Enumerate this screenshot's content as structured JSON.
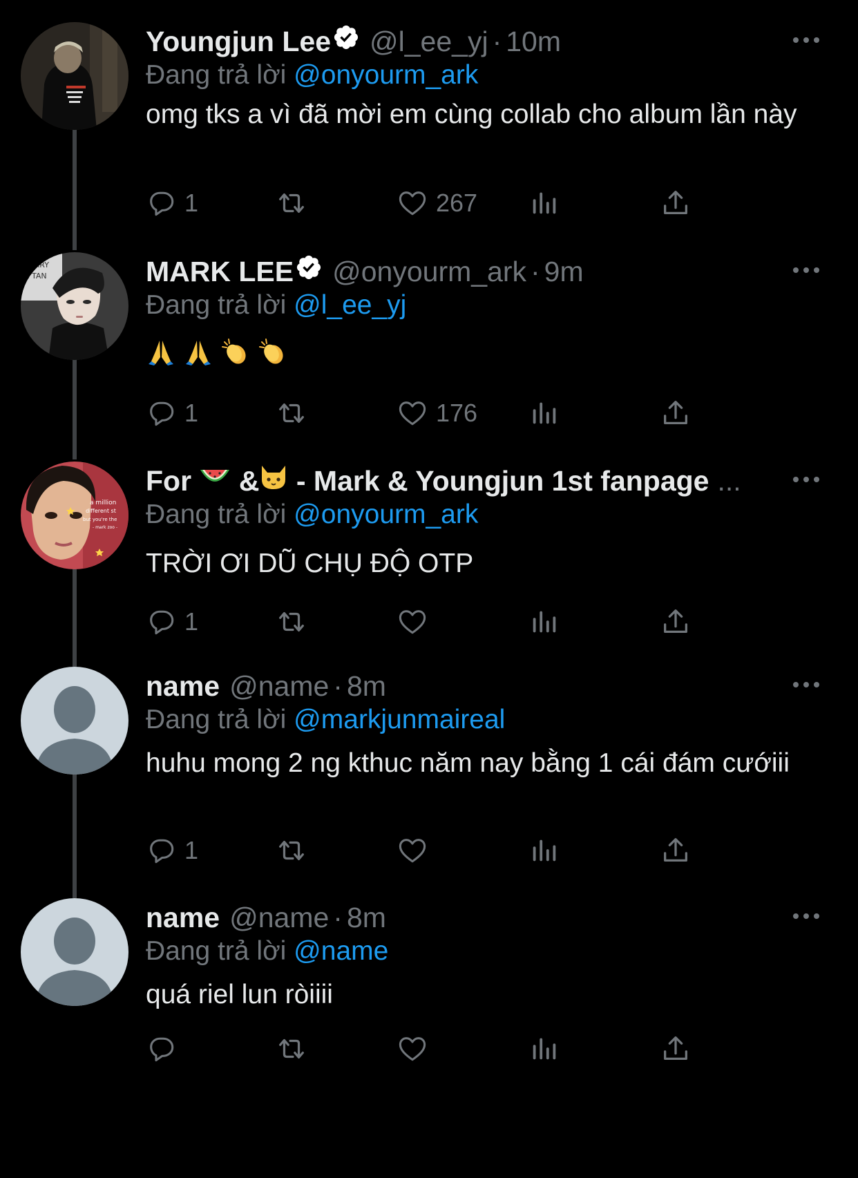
{
  "colors": {
    "background": "#000000",
    "text": "#e7e9ea",
    "secondary": "#71767b",
    "link": "#1d9bf0",
    "thread_line": "#3e4144"
  },
  "reply_prefix": "Đang trả lời",
  "tweets": [
    {
      "display_name": "Youngjun Lee",
      "verified": true,
      "handle": "@l_ee_yj",
      "time": "10m",
      "reply_to": "@onyourm_ark",
      "text": "omg tks a vì đã mời em cùng collab cho album lần này",
      "reply_count": "1",
      "like_count": "267",
      "avatar": "photo-dark-hoodie"
    },
    {
      "display_name": "MARK LEE",
      "verified": true,
      "handle": "@onyourm_ark",
      "time": "9m",
      "reply_to": "@l_ee_yj",
      "text": "",
      "emoji": [
        "folded-hands-emoji",
        "folded-hands-emoji",
        "clapping-hands-emoji",
        "clapping-hands-emoji"
      ],
      "reply_count": "1",
      "like_count": "176",
      "avatar": "photo-portrait"
    },
    {
      "display_name_parts": [
        "For",
        "&",
        "- Mark & Youngjun 1st fanpage"
      ],
      "name_emoji": [
        "watermelon-emoji",
        "cat-face-emoji"
      ],
      "truncated": "...",
      "verified": false,
      "reply_to": "@onyourm_ark",
      "text": "TRỜI ƠI DŨ CHỤ ĐỘ OTP",
      "reply_count": "1",
      "like_count": "",
      "avatar": "photo-fanpage",
      "avatar_caption": [
        "a million",
        "different st",
        "but you're the",
        "- mark zoo -"
      ]
    },
    {
      "display_name": "name",
      "verified": false,
      "handle": "@name",
      "time": "8m",
      "reply_to": "@markjunmaireal",
      "text": "huhu mong 2 ng kthuc năm nay bằng 1 cái đám cướiii",
      "reply_count": "1",
      "like_count": "",
      "avatar": "default-avatar"
    },
    {
      "display_name": "name",
      "verified": false,
      "handle": "@name",
      "time": "8m",
      "reply_to": "@name",
      "text": "quá riel lun ròiiii",
      "reply_count": "",
      "like_count": "",
      "avatar": "default-avatar"
    }
  ],
  "dot_separator": "·"
}
